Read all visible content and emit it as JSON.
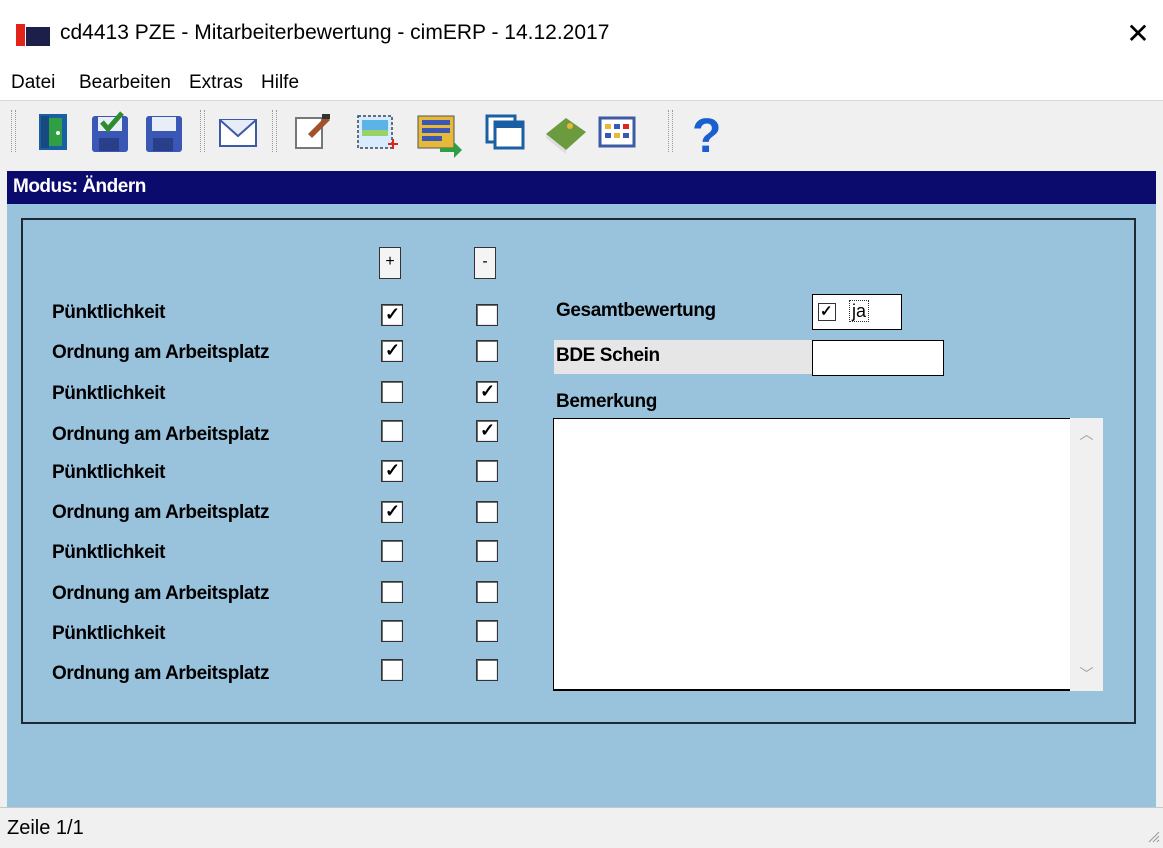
{
  "window": {
    "title": "cd4413 PZE - Mitarbeiterbewertung - cimERP - 14.12.2017",
    "close_glyph": "✕"
  },
  "menu": [
    "Datei",
    "Bearbeiten",
    "Extras",
    "Hilfe"
  ],
  "toolbar": {
    "icons": [
      "exit-door-icon",
      "save-confirm-icon",
      "save-icon",
      "mail-icon",
      "edit-document-icon",
      "new-record-icon",
      "transfer-list-icon",
      "windows-icon",
      "book-icon",
      "calendar-grid-icon",
      "help-icon"
    ]
  },
  "mode": {
    "text": "Modus: Ändern"
  },
  "form": {
    "plus_label": "+",
    "minus_label": "-",
    "rows": [
      {
        "label": "Pünktlichkeit",
        "plus": true,
        "minus": false
      },
      {
        "label": "Ordnung am Arbeitsplatz",
        "plus": true,
        "minus": false
      },
      {
        "label": "Pünktlichkeit",
        "plus": false,
        "minus": true
      },
      {
        "label": "Ordnung am Arbeitsplatz",
        "plus": false,
        "minus": true
      },
      {
        "label": "Pünktlichkeit",
        "plus": true,
        "minus": false
      },
      {
        "label": "Ordnung am Arbeitsplatz",
        "plus": true,
        "minus": false
      },
      {
        "label": "Pünktlichkeit",
        "plus": false,
        "minus": false
      },
      {
        "label": "Ordnung am Arbeitsplatz",
        "plus": false,
        "minus": false
      },
      {
        "label": "Pünktlichkeit",
        "plus": false,
        "minus": false
      },
      {
        "label": "Ordnung am Arbeitsplatz",
        "plus": false,
        "minus": false
      }
    ],
    "gesamt_label": "Gesamtbewertung",
    "gesamt_checked": true,
    "gesamt_value": "ja",
    "bde_label": "BDE Schein",
    "bde_value": "",
    "bemerkung_label": "Bemerkung",
    "bemerkung_value": ""
  },
  "status": {
    "text": "Zeile 1/1"
  },
  "colors": {
    "mode_bar": "#0b0b6e",
    "form_bg": "#99c2dd"
  }
}
